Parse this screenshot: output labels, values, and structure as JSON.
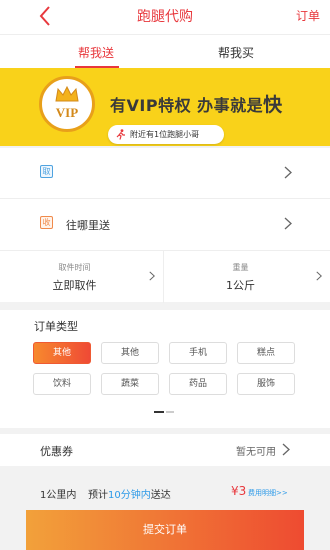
{
  "header": {
    "title": "跑腿代购",
    "order_label": "订单"
  },
  "tabs": [
    {
      "label": "帮我送",
      "active": true
    },
    {
      "label": "帮我买",
      "active": false
    }
  ],
  "banner": {
    "vip_badge": "VIP",
    "slogan_prefix": "有",
    "slogan_vip": "VIP",
    "slogan_mid": "特权  办事就是",
    "slogan_end": "快",
    "nearby_text": "附近有1位跑腿小哥"
  },
  "address": {
    "pickup_tag": "取",
    "pickup_text": "",
    "delivery_tag": "收",
    "delivery_placeholder": "往哪里送"
  },
  "info": {
    "pickup_time_label": "取件时间",
    "pickup_time_value": "立即取件",
    "weight_label": "重量",
    "weight_value": "1公斤"
  },
  "order_type": {
    "title": "订单类型",
    "options": [
      "其他",
      "其他",
      "手机",
      "糕点",
      "饮料",
      "蔬菜",
      "药品",
      "服饰"
    ],
    "selected_index": 0
  },
  "coupon": {
    "label": "优惠券",
    "value": "暂无可用"
  },
  "summary": {
    "distance": "1公里内",
    "estimate_prefix": "预计",
    "estimate_time": "10分钟内",
    "estimate_suffix": "送达",
    "price": "¥3",
    "detail_link": "费用明细>>"
  },
  "submit_label": "提交订单",
  "colors": {
    "accent": "#e8383d",
    "banner": "#f9d21a",
    "link": "#2d9ae8"
  }
}
